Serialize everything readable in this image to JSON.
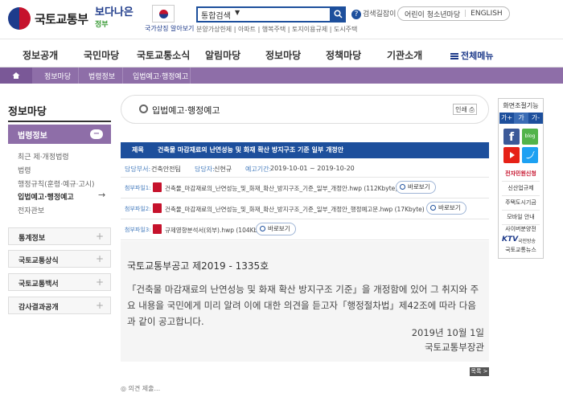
{
  "header": {
    "logo_text": "국토교통부",
    "slogan_top": "보다나은",
    "slogan_bottom": "정부",
    "flag_caption": "국가상징 알아보기",
    "search_select": "통합검색",
    "search_links": "분양가상한제 | 아파트 | 행복주택 | 토지이용규제 | 도시주택",
    "help_label": "검색길잡이",
    "top_link_1": "어린이 청소년마당",
    "top_link_2": "ENGLISH"
  },
  "gnb": {
    "items": [
      "정보공개",
      "국민마당",
      "국토교통소식",
      "알림마당",
      "정보마당",
      "정책마당",
      "기관소개"
    ],
    "all_menu": "전체메뉴"
  },
  "breadcrumb": [
    "정보마당",
    "법령정보",
    "입법예고·행정예고"
  ],
  "sidebar": {
    "title": "정보마당",
    "active": "법령정보",
    "active_toggle": "−",
    "sub_items": [
      "최근 제·개정법령",
      "법령",
      "행정규칙(훈령·예규·고시)",
      "입법예고·행정예고",
      "전자관보"
    ],
    "sections": [
      "통계정보",
      "국토교통상식",
      "국토교통백서",
      "감사결과공개"
    ],
    "plus": "+"
  },
  "main": {
    "page_title": "입법예고·행정예고",
    "print_label": "인쇄",
    "subject_key": "제목",
    "subject": "건축물 마감재료의 난연성능 및 화재 확산 방지구조 기준 일부 개정안",
    "dept_key": "담당부서:",
    "dept": "건축안전팀",
    "person_key": "담당자:",
    "person": "신현규",
    "period_key": "예고기간:",
    "period": "2019-10-01 ~ 2019-10-20",
    "attach_key": "첨부파일1:",
    "attach_key2": "첨부파일2:",
    "attach_key3": "첨부파일3:",
    "view_label": "바로보기",
    "files": [
      "건축물_마감재료의_난연성능_및_화재_확산_방지구조_기준_일부_개정안.hwp (112Kbyte)",
      "건축물_마감재료의_난연성능_및_화재_확산_방지구조_기준_일부_개정안_행정예고문.hwp (17Kbyte)",
      "규제영향분석서(외부).hwp (104Kbyte)"
    ],
    "notice_no": "국토교통부공고 제2019 -   1335호",
    "notice_body": "「건축물 마감재료의 난연성능 및 화재 확산 방지구조 기준」을 개정함에 있어 그 취지와 주요 내용을 국민에게 미리 알려 이에 대한 의견을 듣고자「행정절차법」제42조에 따라 다음과 같이 공고합니다.",
    "notice_date": "2019년 10월 1일",
    "notice_sig": "국토교통부장관",
    "list_label": "목록 >",
    "bottom_fragment": "◎ 의견 제출..."
  },
  "quick": {
    "title": "화면조절기능",
    "font_plus": "가+",
    "font_reset": "가",
    "font_minus": "가-",
    "sns_blog": "blog",
    "items": [
      "전자민원신청",
      "신산업규제",
      "주택도시기금",
      "모바일 안내",
      "사이버분양전"
    ],
    "ktv_logo": "KTV",
    "ktv_sub": "국민방송",
    "ktv_name": "국토교통뉴스"
  },
  "colors": {
    "brand_blue": "#1d4f9c",
    "purple": "#8e6ea8",
    "red": "#c6122c"
  }
}
